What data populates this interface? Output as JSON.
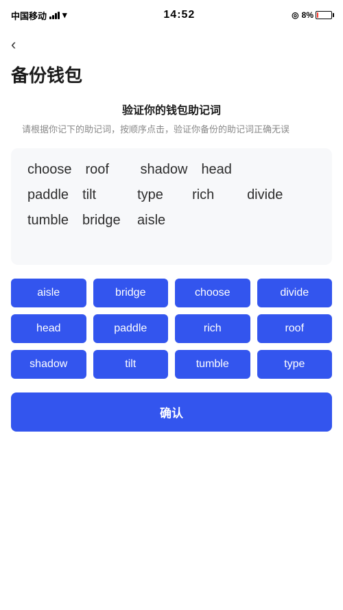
{
  "statusBar": {
    "carrier": "中国移动",
    "time": "14:52",
    "battery_pct": "8%"
  },
  "backButton": {
    "label": "‹"
  },
  "pageTitle": "备份钱包",
  "sectionTitle": "验证你的钱包助记词",
  "sectionDesc": "请根据你记下的助记词，按顺序点击，验证你备份的助记词正确无误",
  "displayWords": {
    "row1": [
      "choose",
      "roof",
      "shadow",
      "head"
    ],
    "row2": [
      "paddle",
      "tilt",
      "type",
      "rich",
      "divide"
    ],
    "row3": [
      "tumble",
      "bridge",
      "aisle"
    ]
  },
  "chips": [
    {
      "id": "aisle",
      "label": "aisle",
      "selected": false
    },
    {
      "id": "bridge",
      "label": "bridge",
      "selected": false
    },
    {
      "id": "choose",
      "label": "choose",
      "selected": false
    },
    {
      "id": "divide",
      "label": "divide",
      "selected": false
    },
    {
      "id": "head",
      "label": "head",
      "selected": false
    },
    {
      "id": "paddle",
      "label": "paddle",
      "selected": false
    },
    {
      "id": "rich",
      "label": "rich",
      "selected": false
    },
    {
      "id": "roof",
      "label": "roof",
      "selected": false
    },
    {
      "id": "shadow",
      "label": "shadow",
      "selected": false
    },
    {
      "id": "tilt",
      "label": "tilt",
      "selected": false
    },
    {
      "id": "tumble",
      "label": "tumble",
      "selected": false
    },
    {
      "id": "type",
      "label": "type",
      "selected": false
    }
  ],
  "confirmButton": {
    "label": "确认"
  }
}
